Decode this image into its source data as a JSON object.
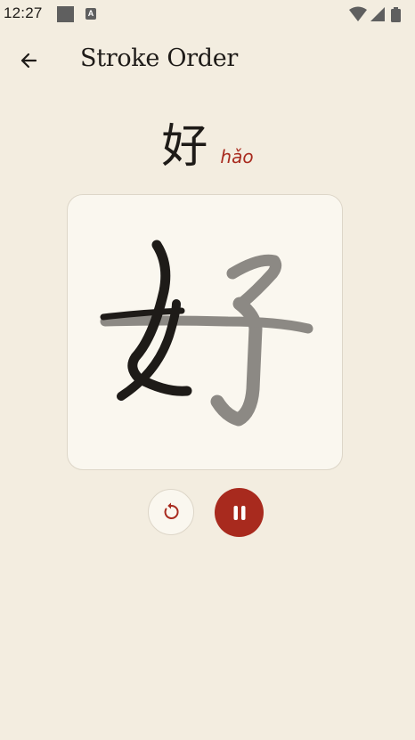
{
  "status_bar": {
    "time": "12:27",
    "icons": [
      "notification-square-icon",
      "a-badge-icon",
      "wifi-icon",
      "cell-signal-icon",
      "battery-icon"
    ]
  },
  "app_bar": {
    "title": "Stroke Order",
    "back_icon": "arrow-left-icon"
  },
  "character": {
    "hanzi": "好",
    "pinyin": "hǎo"
  },
  "stroke_animation": {
    "completed_strokes": 3,
    "total_strokes": 6,
    "progress": 0.5,
    "state": "playing"
  },
  "controls": {
    "replay_icon": "replay-icon",
    "pause_icon": "pause-icon"
  },
  "colors": {
    "background": "#f3ede0",
    "card": "#faf7ef",
    "accent": "#a82a1e",
    "stroke_done": "#1e1b18",
    "stroke_pending": "#8c8984"
  }
}
